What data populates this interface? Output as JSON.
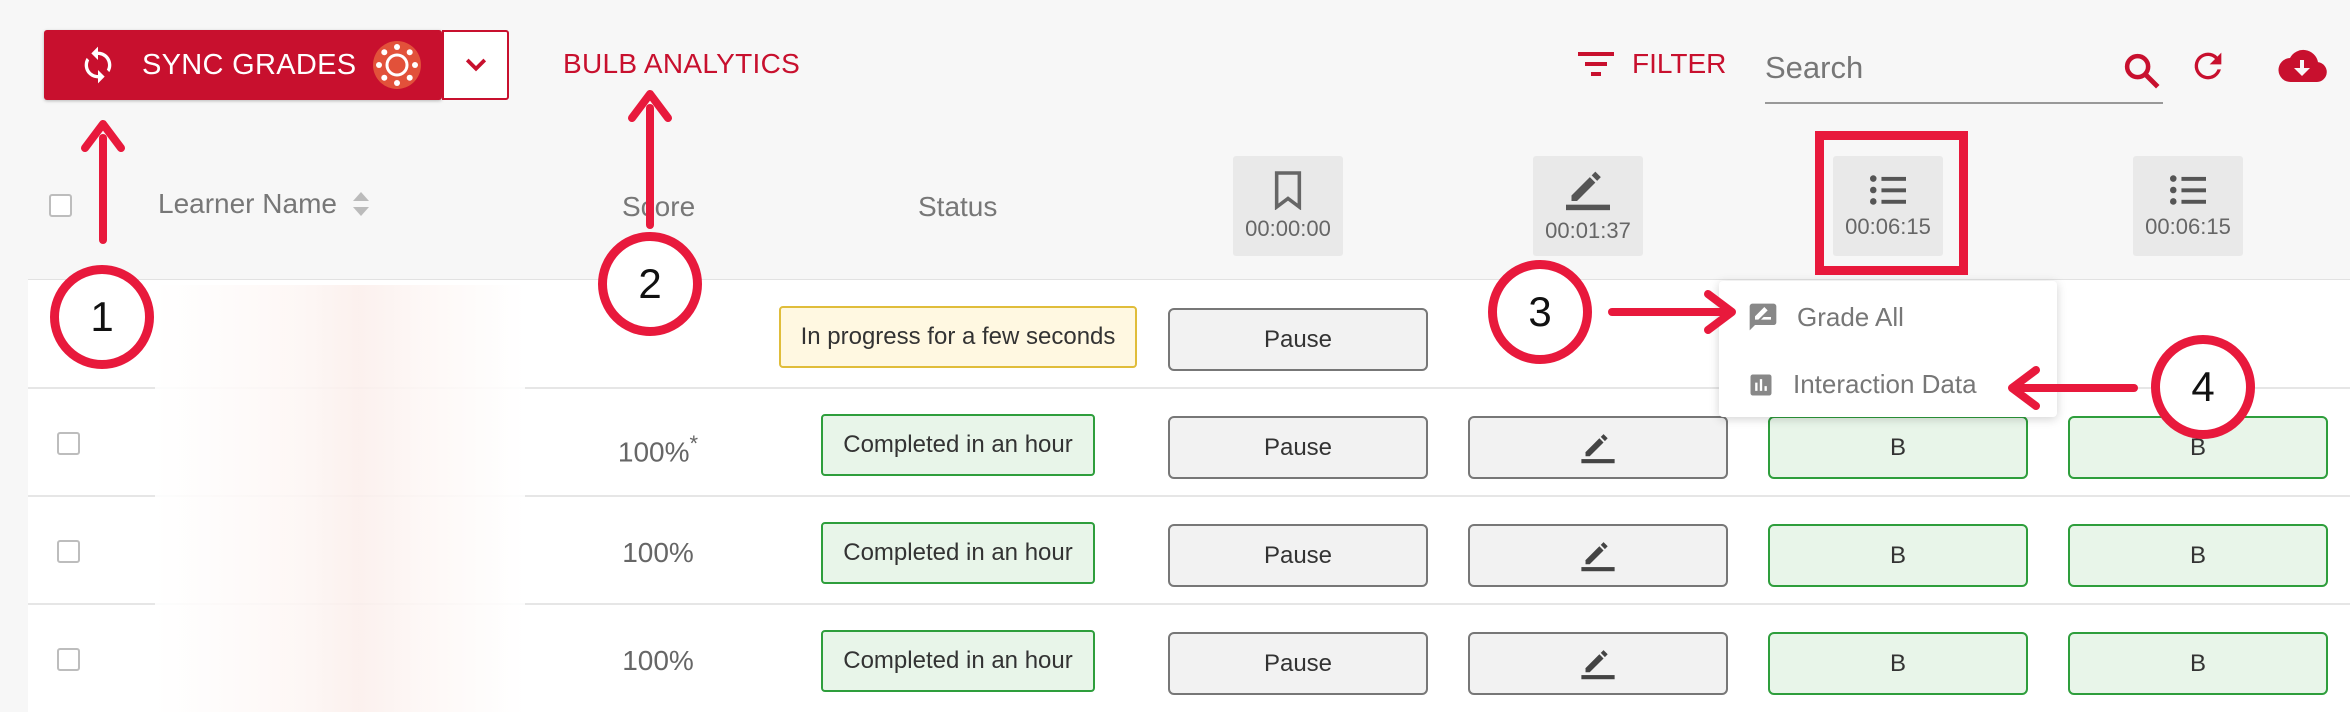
{
  "toolbar": {
    "sync_label": "SYNC GRADES",
    "bulb_analytics": "BULB ANALYTICS",
    "filter_label": "FILTER",
    "search_placeholder": "Search"
  },
  "table": {
    "headers": {
      "learner_name": "Learner Name",
      "score": "Score",
      "status": "Status"
    },
    "activities": [
      {
        "icon": "bookmark-icon",
        "time": "00:00:00"
      },
      {
        "icon": "pencil-icon",
        "time": "00:01:37"
      },
      {
        "icon": "list-icon",
        "time": "00:06:15"
      },
      {
        "icon": "list-icon",
        "time": "00:06:15"
      }
    ],
    "rows": [
      {
        "score": "",
        "asterisk": "",
        "status": "In progress for a few seconds",
        "pause": "Pause",
        "grade3": "",
        "grade4": ""
      },
      {
        "score": "100%",
        "asterisk": "*",
        "status": "Completed in an hour",
        "pause": "Pause",
        "grade3": "B",
        "grade4": "B"
      },
      {
        "score": "100%",
        "asterisk": "",
        "status": "Completed in an hour",
        "pause": "Pause",
        "grade3": "B",
        "grade4": "B"
      },
      {
        "score": "100%",
        "asterisk": "",
        "status": "Completed in an hour",
        "pause": "Pause",
        "grade3": "B",
        "grade4": "B"
      }
    ]
  },
  "menu": {
    "grade_all": "Grade All",
    "interaction_data": "Interaction Data"
  },
  "callouts": [
    "1",
    "2",
    "3",
    "4"
  ],
  "colors": {
    "brand_red": "#c8102e",
    "annotation_red": "#e8193c",
    "success_green": "#2e9e3c",
    "warning_yellow": "#e0bd3a"
  }
}
